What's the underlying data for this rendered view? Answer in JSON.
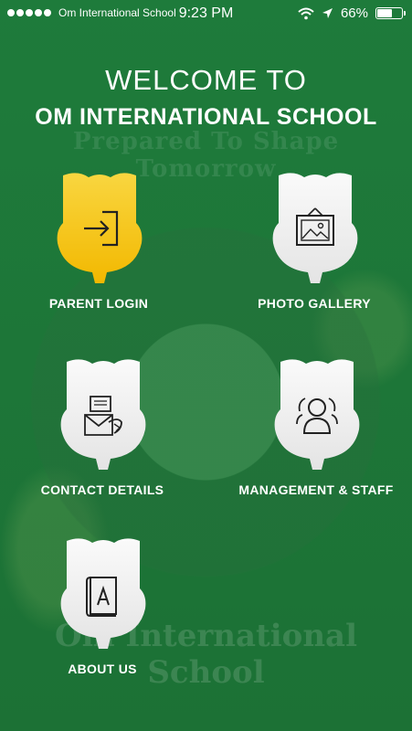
{
  "status_bar": {
    "carrier": "Om International School",
    "time": "9:23 PM",
    "battery": "66%",
    "battery_level": 0.66,
    "signal_dots": 5
  },
  "header": {
    "welcome": "WELCOME TO",
    "school_name": "OM INTERNATIONAL SCHOOL"
  },
  "background": {
    "faded_tagline": "Prepared To Shape Tomorrow",
    "faded_name": "Om International School"
  },
  "tiles": [
    {
      "label": "PARENT LOGIN",
      "icon": "login-icon",
      "active": true
    },
    {
      "label": "PHOTO GALLERY",
      "icon": "picture-frame-icon",
      "active": false
    },
    {
      "label": "CONTACT DETAILS",
      "icon": "contact-mail-icon",
      "active": false
    },
    {
      "label": "MANAGEMENT & STAFF",
      "icon": "staff-group-icon",
      "active": false
    },
    {
      "label": "ABOUT US",
      "icon": "book-icon",
      "active": false
    }
  ],
  "colors": {
    "background_green": "#1e7b3b",
    "active_tile": "#f6c900",
    "inactive_tile": "#f2f2f2",
    "text": "#ffffff"
  }
}
